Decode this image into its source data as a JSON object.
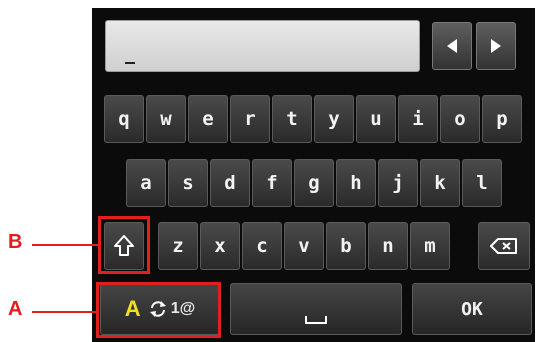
{
  "keyboard": {
    "row1": [
      "q",
      "w",
      "e",
      "r",
      "t",
      "y",
      "u",
      "i",
      "o",
      "p"
    ],
    "row2": [
      "a",
      "s",
      "d",
      "f",
      "g",
      "h",
      "j",
      "k",
      "l"
    ],
    "row3": [
      "z",
      "x",
      "c",
      "v",
      "b",
      "n",
      "m"
    ],
    "mode_letter": "A",
    "mode_symbols": "1@",
    "ok_label": "OK"
  },
  "input": {
    "cursor": "_"
  },
  "callouts": {
    "a": "A",
    "b": "B"
  },
  "icons": {
    "left": "left-arrow-icon",
    "right": "right-arrow-icon",
    "shift": "shift-arrow-icon",
    "backspace": "backspace-icon",
    "mode_cycle": "cycle-icon",
    "space": "space-bar-icon"
  },
  "colors": {
    "callout": "#e0201f",
    "mode_letter": "#f0e020",
    "key_text": "#f2f2f2"
  }
}
